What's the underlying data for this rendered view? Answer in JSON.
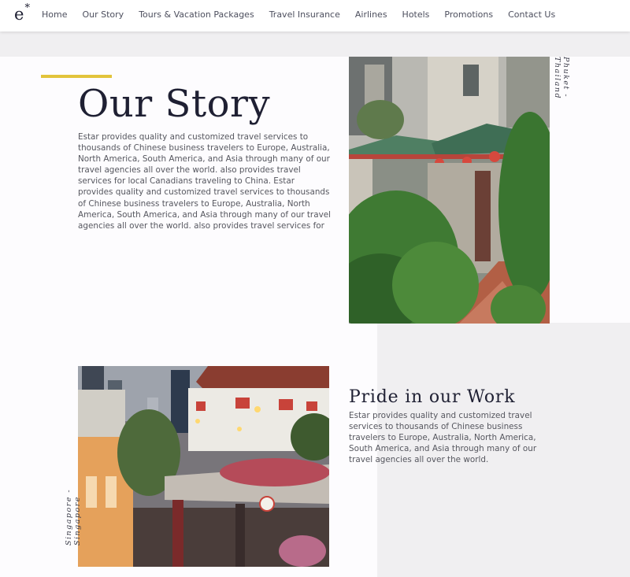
{
  "nav": {
    "logo": "e",
    "logo_star": "*",
    "items": [
      "Home",
      "Our Story",
      "Tours & Vacation Packages",
      "Travel Insurance",
      "Airlines",
      "Hotels",
      "Promotions",
      "Contact Us"
    ]
  },
  "story": {
    "title": "Our Story",
    "body": "Estar provides quality and customized travel services to thousands of Chinese business travelers to Europe, Australia, North America, South America, and Asia through many of our travel agencies all over the world. also provides travel services for local Canadians traveling to China. Estar provides quality and customized travel services to thousands of Chinese business travelers to Europe, Australia, North America, South America, and Asia through many of our travel agencies all over the world. also provides travel services for"
  },
  "photos": {
    "temple_caption": "Phuket - Thailand",
    "singapore_caption": "Singapore - Singapore"
  },
  "pride": {
    "title": "Pride in our Work",
    "body": "Estar provides quality and customized travel services to thousands of Chinese business travelers to Europe, Australia, North America, South America, and Asia through many of our travel agencies all over the world."
  },
  "colors": {
    "accent_yellow": "#e2c43b",
    "heading": "#1f2033",
    "background": "#f0eff1"
  }
}
